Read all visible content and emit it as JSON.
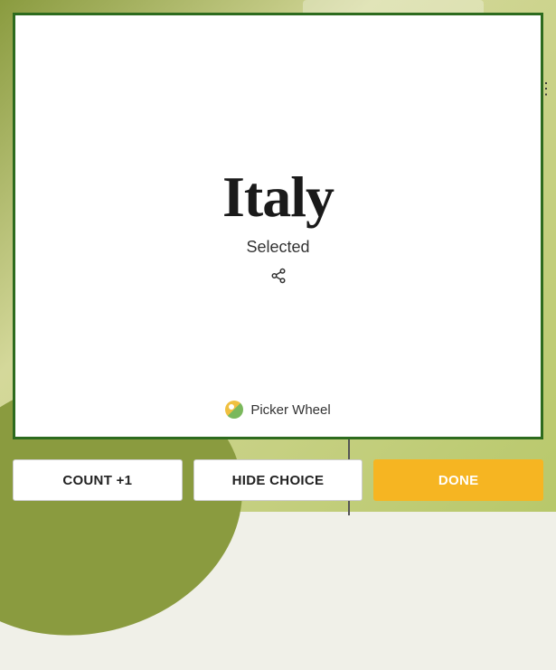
{
  "result": {
    "title": "Italy",
    "subtitle": "Selected"
  },
  "brand": {
    "name": "Picker Wheel"
  },
  "buttons": {
    "count": "COUNT +1",
    "hide": "HIDE CHOICE",
    "done": "DONE"
  }
}
